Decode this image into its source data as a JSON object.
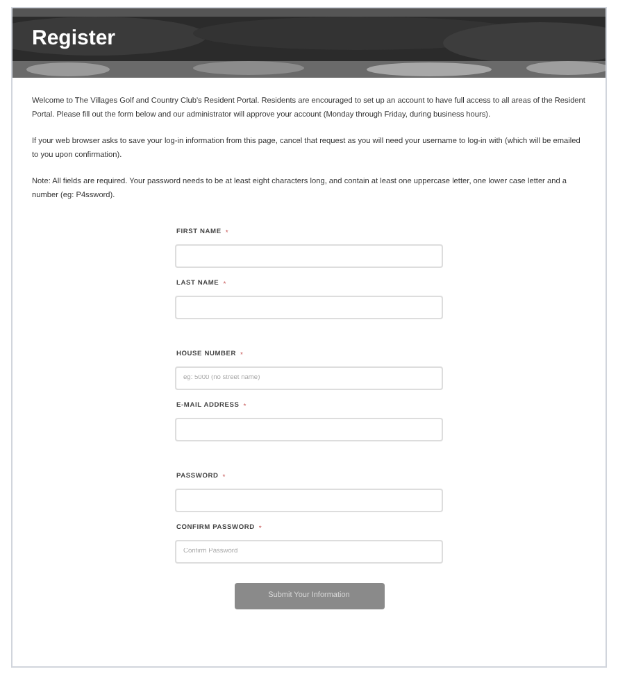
{
  "header": {
    "title": "Register",
    "kind": "picture"
  },
  "paragraphs": [
    "Welcome to The Villages Golf and Country Club's Resident Portal. Residents are encouraged to set up an account to have full access to all areas of the Resident Portal. Please fill out the form below and our administrator will approve your account (Monday through Friday, during business hours).",
    "If your web browser asks to save your log-in information from this page, cancel that request as you will need your username to log-in with (which will be emailed to you upon confirmation).",
    "Note: All fields are required. Your password needs to be at least eight characters long, and contain at least one uppercase letter, one lower case letter and a number (eg: P4ssword)."
  ],
  "field_groups": [
    [
      {
        "label": "FIRST NAME",
        "required_mark": "*"
      },
      {
        "label": "LAST NAME",
        "required_mark": "*"
      }
    ],
    [
      {
        "label": "HOUSE NUMBER",
        "required_mark": "*",
        "placeholder": "eg: 5000 (no street name)"
      },
      {
        "label": "E-MAIL ADDRESS",
        "required_mark": "*"
      }
    ],
    [
      {
        "label": "PASSWORD",
        "required_mark": "*"
      },
      {
        "label": "CONFIRM PASSWORD",
        "required_mark": "*",
        "placeholder": "Confirm Password"
      }
    ]
  ],
  "submit_button": "Submit Your Information"
}
